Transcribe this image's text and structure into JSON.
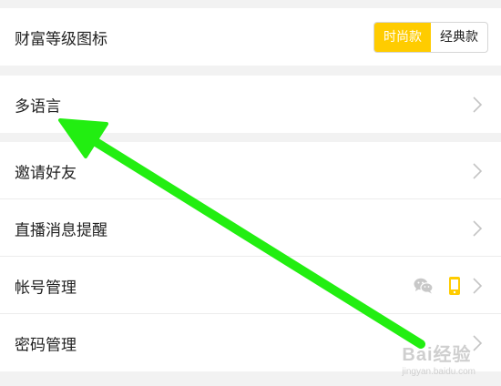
{
  "settings": {
    "wealth_level_icon": {
      "label": "财富等级图标",
      "options": [
        "时尚款",
        "经典款"
      ],
      "selected": "时尚款"
    },
    "language": {
      "label": "多语言"
    },
    "invite_friends": {
      "label": "邀请好友"
    },
    "live_reminder": {
      "label": "直播消息提醒"
    },
    "account_management": {
      "label": "帐号管理",
      "icons": [
        "wechat-icon",
        "phone-icon"
      ]
    },
    "password_management": {
      "label": "密码管理"
    }
  },
  "colors": {
    "accent": "#ffcc00",
    "annotation_arrow": "#22ee11",
    "wechat_icon": "#c8c8c8",
    "chevron": "#c4c4c4"
  },
  "watermark": {
    "text": "Bai经验",
    "sub": "jingyan.baidu.com"
  }
}
